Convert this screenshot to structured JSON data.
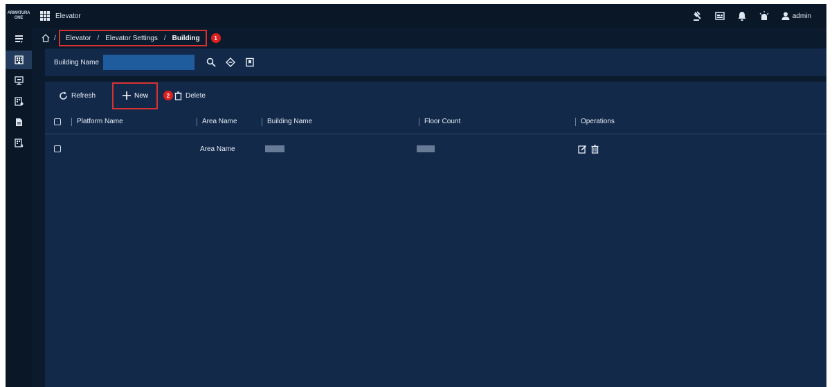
{
  "brand": {
    "logo_line1": "ARMATURA",
    "logo_line2": "ONE"
  },
  "header": {
    "app_title": "Elevator",
    "username": "admin"
  },
  "breadcrumb": {
    "separator": "/",
    "items": [
      "Elevator",
      "Elevator Settings",
      "Building"
    ]
  },
  "markers": {
    "first": "1",
    "second": "2"
  },
  "search": {
    "label": "Building Name",
    "value": ""
  },
  "toolbar": {
    "refresh_label": "Refresh",
    "new_label": "New",
    "delete_label": "Delete"
  },
  "table": {
    "columns": [
      "Platform Name",
      "Area Name",
      "Building Name",
      "Floor Count",
      "Operations"
    ],
    "rows": [
      {
        "platform_name": "",
        "area_name": "Area Name"
      }
    ]
  },
  "colors": {
    "accent_red": "#d8322e",
    "panel": "#13294a",
    "background": "#0b1a2c",
    "input": "#1f5c9e"
  }
}
